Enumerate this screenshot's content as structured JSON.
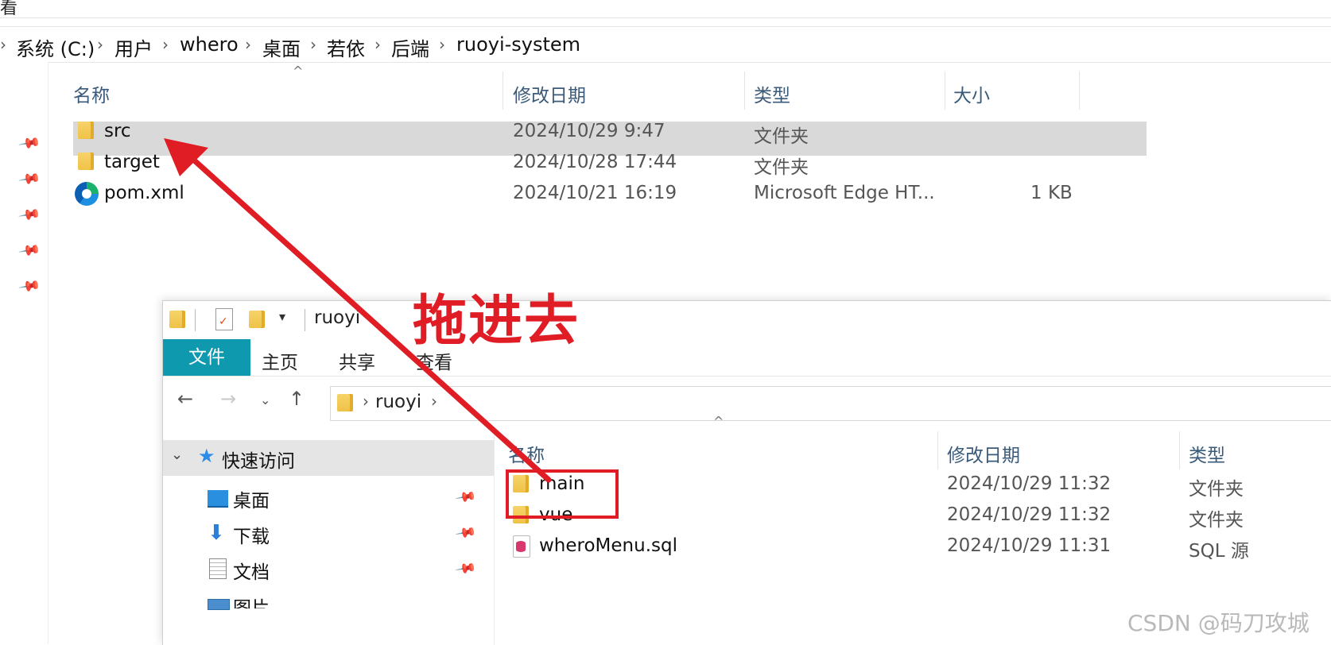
{
  "top_strip": {
    "text": "看"
  },
  "breadcrumb": [
    "系统 (C:)",
    "用户",
    "whero",
    "桌面",
    "若依",
    "后端",
    "ruoyi-system"
  ],
  "main_list": {
    "columns": [
      "名称",
      "修改日期",
      "类型",
      "大小"
    ],
    "rows": [
      {
        "name": "src",
        "date": "2024/10/29 9:47",
        "type": "文件夹",
        "size": "",
        "icon": "folder-icon",
        "selected": true
      },
      {
        "name": "target",
        "date": "2024/10/28 17:44",
        "type": "文件夹",
        "size": "",
        "icon": "folder-icon"
      },
      {
        "name": "pom.xml",
        "date": "2024/10/21 16:19",
        "type": "Microsoft Edge HT...",
        "size": "1 KB",
        "icon": "edge-icon"
      }
    ]
  },
  "win2": {
    "title": "ruoyi",
    "ribbon_tabs": {
      "file": "文件",
      "home": "主页",
      "share": "共享",
      "view": "查看"
    },
    "address": "ruoyi",
    "nav_icons": [
      "back-arrow-icon",
      "forward-arrow-icon",
      "recent-dropdown-icon",
      "up-arrow-icon"
    ],
    "pane": {
      "quick_access": "快速访问",
      "items": [
        {
          "label": "桌面",
          "icon": "desktop-icon"
        },
        {
          "label": "下载",
          "icon": "download-icon"
        },
        {
          "label": "文档",
          "icon": "documents-icon"
        },
        {
          "label": "图片",
          "icon": "pictures-icon"
        }
      ]
    },
    "columns": [
      "名称",
      "修改日期",
      "类型"
    ],
    "rows": [
      {
        "name": "main",
        "date": "2024/10/29 11:32",
        "type": "文件夹",
        "icon": "folder-icon"
      },
      {
        "name": "vue",
        "date": "2024/10/29 11:32",
        "type": "文件夹",
        "icon": "folder-icon"
      },
      {
        "name": "wheroMenu.sql",
        "date": "2024/10/29 11:31",
        "type": "SQL 源",
        "icon": "sql-file-icon"
      }
    ]
  },
  "annotation": {
    "text": "拖进去",
    "color": "#e01c24"
  },
  "watermark": "CSDN @码刀攻城",
  "colors": {
    "accent": "#0f99ae",
    "selection": "#d9d9d9",
    "header_text": "#3a5a7a"
  }
}
